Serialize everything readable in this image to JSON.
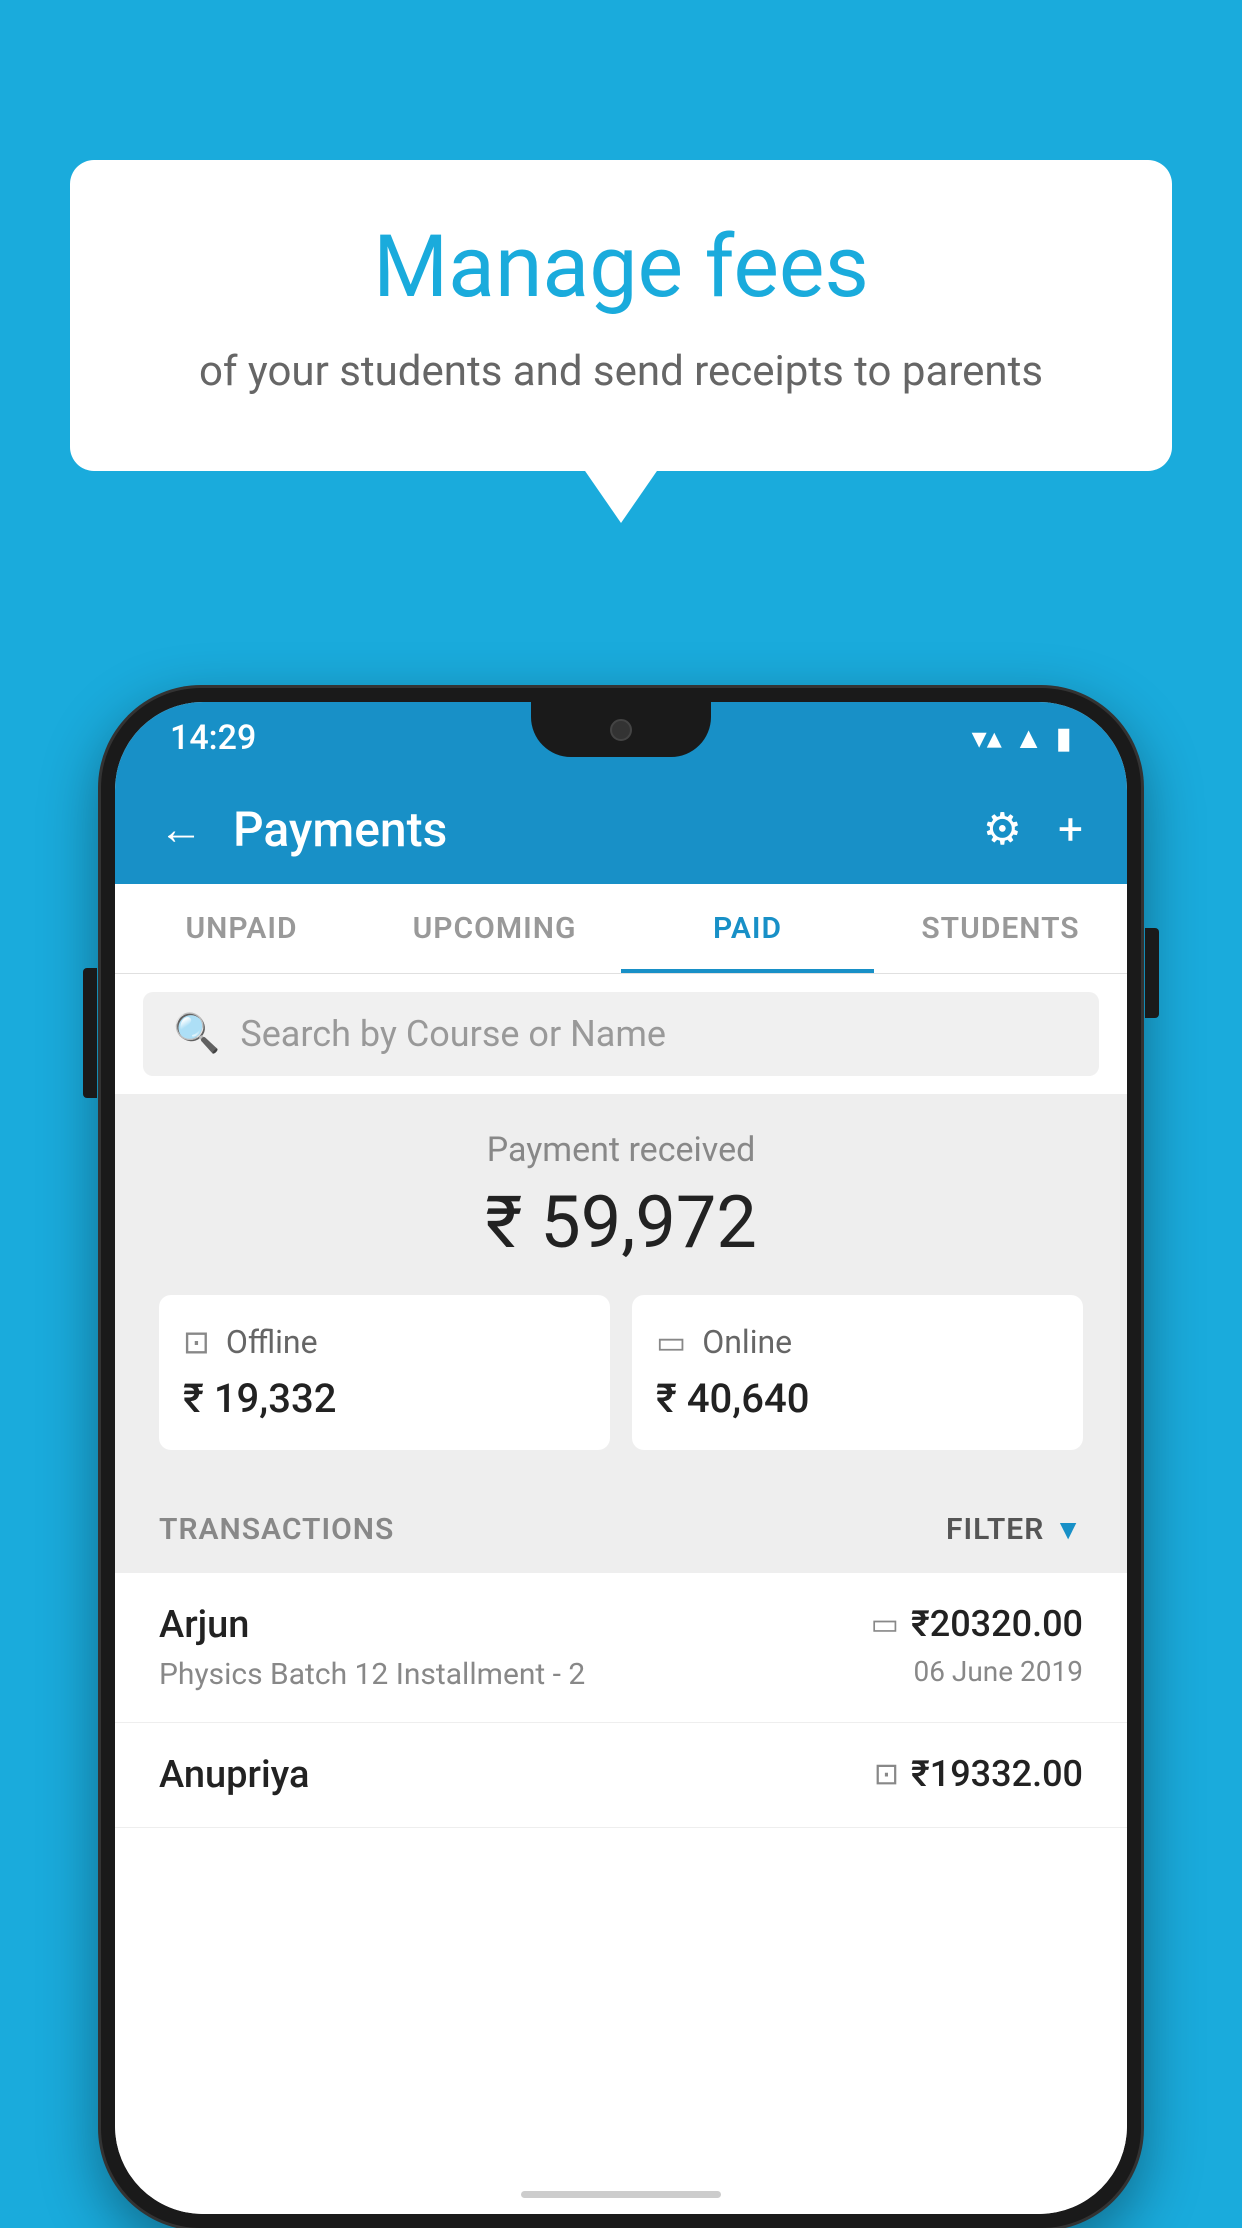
{
  "background_color": "#1AABDC",
  "speech_bubble": {
    "title": "Manage fees",
    "subtitle": "of your students and send receipts to parents"
  },
  "status_bar": {
    "time": "14:29",
    "wifi_icon": "▼",
    "signal_icon": "▲",
    "battery_icon": "▮"
  },
  "header": {
    "back_label": "←",
    "title": "Payments",
    "settings_icon": "⚙",
    "add_icon": "+"
  },
  "tabs": [
    {
      "label": "UNPAID",
      "active": false
    },
    {
      "label": "UPCOMING",
      "active": false
    },
    {
      "label": "PAID",
      "active": true
    },
    {
      "label": "STUDENTS",
      "active": false
    }
  ],
  "search": {
    "placeholder": "Search by Course or Name"
  },
  "payment_summary": {
    "label": "Payment received",
    "amount": "₹ 59,972",
    "offline": {
      "icon": "💳",
      "label": "Offline",
      "amount": "₹ 19,332"
    },
    "online": {
      "icon": "💳",
      "label": "Online",
      "amount": "₹ 40,640"
    }
  },
  "transactions": {
    "header_label": "TRANSACTIONS",
    "filter_label": "FILTER",
    "items": [
      {
        "name": "Arjun",
        "description": "Physics Batch 12 Installment - 2",
        "amount": "₹20320.00",
        "date": "06 June 2019",
        "payment_type": "online"
      },
      {
        "name": "Anupriya",
        "description": "",
        "amount": "₹19332.00",
        "date": "",
        "payment_type": "offline"
      }
    ]
  }
}
